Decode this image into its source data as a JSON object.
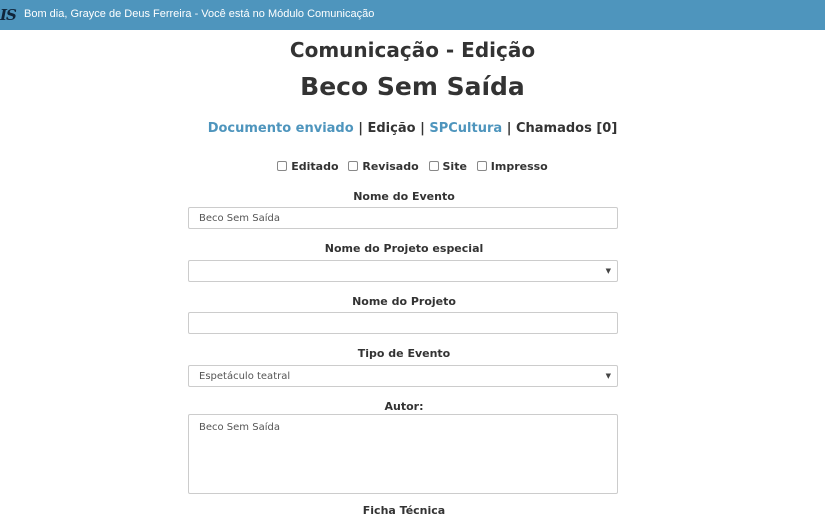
{
  "header": {
    "logo_text": "IS",
    "greeting": "Bom dia, Grayce de Deus Ferreira - Você está no Módulo Comunicação"
  },
  "page": {
    "module_title": "Comunicação - Edição",
    "event_title": "Beco Sem Saída"
  },
  "nav_links": {
    "documento": "Documento enviado",
    "edicao": "Edição",
    "spcultura": "SPCultura",
    "chamados": "Chamados [0]",
    "separator": "|"
  },
  "status_checks": [
    {
      "label": "Editado",
      "checked": false
    },
    {
      "label": "Revisado",
      "checked": false
    },
    {
      "label": "Site",
      "checked": false
    },
    {
      "label": "Impresso",
      "checked": false
    }
  ],
  "form": {
    "nome_evento": {
      "label": "Nome do Evento",
      "value": "Beco Sem Saída"
    },
    "projeto_especial": {
      "label": "Nome do Projeto especial",
      "value": ""
    },
    "nome_projeto": {
      "label": "Nome do Projeto",
      "value": ""
    },
    "tipo_evento": {
      "label": "Tipo de Evento",
      "value": "Espetáculo teatral"
    },
    "autor": {
      "label": "Autor:",
      "value": "Beco Sem Saída"
    },
    "ficha_tecnica": {
      "label": "Ficha Técnica"
    }
  }
}
